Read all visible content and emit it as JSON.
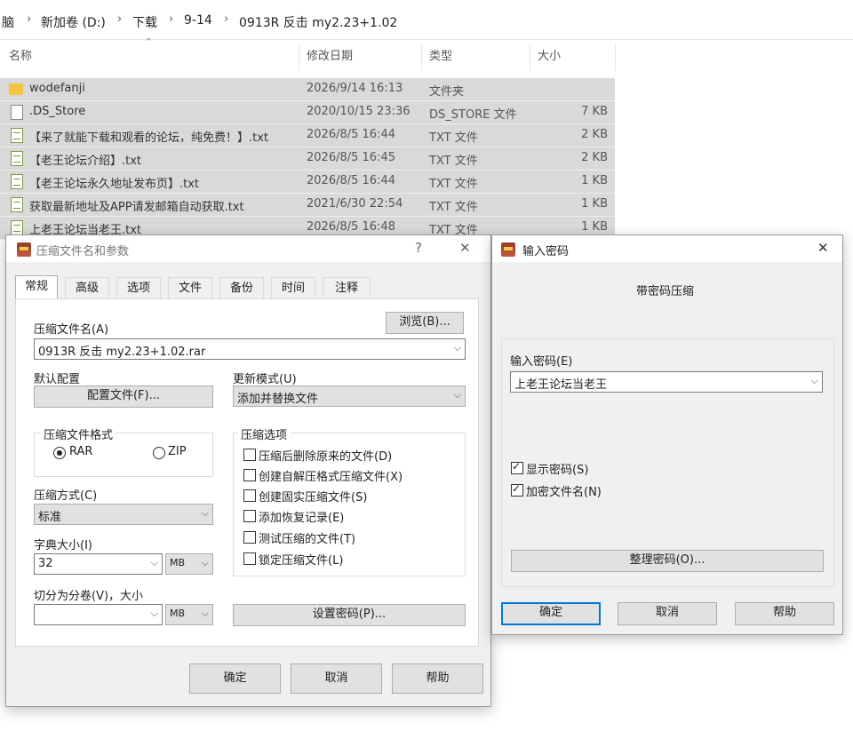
{
  "explorer": {
    "breadcrumb": [
      "脑",
      "新加卷 (D:)",
      "下载",
      "9-14",
      "0913R 反击 my2.23+1.02"
    ],
    "columns": {
      "name": "名称",
      "date": "修改日期",
      "type": "类型",
      "size": "大小"
    },
    "files": [
      {
        "name": "wodefanji",
        "date": "2026/9/14 16:13",
        "type": "文件夹",
        "size": "",
        "icon": "folder-icon"
      },
      {
        "name": ".DS_Store",
        "date": "2020/10/15 23:36",
        "type": "DS_STORE 文件",
        "size": "7 KB",
        "icon": "file-icon"
      },
      {
        "name": "【来了就能下载和观看的论坛，纯免费！】.txt",
        "date": "2026/8/5 16:44",
        "type": "TXT 文件",
        "size": "2 KB",
        "icon": "txt-icon"
      },
      {
        "name": "【老王论坛介绍】.txt",
        "date": "2026/8/5 16:45",
        "type": "TXT 文件",
        "size": "2 KB",
        "icon": "txt-icon"
      },
      {
        "name": "【老王论坛永久地址发布页】.txt",
        "date": "2026/8/5 16:44",
        "type": "TXT 文件",
        "size": "1 KB",
        "icon": "txt-icon"
      },
      {
        "name": "获取最新地址及APP请发邮箱自动获取.txt",
        "date": "2021/6/30 22:54",
        "type": "TXT 文件",
        "size": "1 KB",
        "icon": "txt-icon"
      },
      {
        "name": "上老王论坛当老王.txt",
        "date": "2026/8/5 16:48",
        "type": "TXT 文件",
        "size": "1 KB",
        "icon": "txt-icon"
      }
    ]
  },
  "archive_dialog": {
    "title": "压缩文件名和参数",
    "help_glyph": "?",
    "close_glyph": "✕",
    "tabs": [
      "常规",
      "高级",
      "选项",
      "文件",
      "备份",
      "时间",
      "注释"
    ],
    "filename_label": "压缩文件名(A)",
    "browse": "浏览(B)...",
    "filename": "0913R 反击 my2.23+1.02.rar",
    "profile_label": "默认配置",
    "profile_button": "配置文件(F)...",
    "update_label": "更新模式(U)",
    "update_value": "添加并替换文件",
    "format_label": "压缩文件格式",
    "format_rar": "RAR",
    "format_zip": "ZIP",
    "method_label": "压缩方式(C)",
    "method_value": "标准",
    "dict_label": "字典大小(I)",
    "dict_value": "32",
    "dict_unit": "MB",
    "split_label": "切分为分卷(V)，大小",
    "split_value": "",
    "split_unit": "MB",
    "options_label": "压缩选项",
    "options": [
      {
        "label": "压缩后删除原来的文件(D)",
        "checked": false
      },
      {
        "label": "创建自解压格式压缩文件(X)",
        "checked": false
      },
      {
        "label": "创建固实压缩文件(S)",
        "checked": false
      },
      {
        "label": "添加恢复记录(E)",
        "checked": false
      },
      {
        "label": "测试压缩的文件(T)",
        "checked": false
      },
      {
        "label": "锁定压缩文件(L)",
        "checked": false
      }
    ],
    "set_password": "设置密码(P)...",
    "ok": "确定",
    "cancel": "取消",
    "help": "帮助"
  },
  "password_dialog": {
    "title": "输入密码",
    "close_glyph": "✕",
    "heading": "带密码压缩",
    "password_label": "输入密码(E)",
    "password_value": "上老王论坛当老王",
    "show_password": "显示密码(S)",
    "show_password_checked": true,
    "encrypt_names": "加密文件名(N)",
    "encrypt_names_checked": true,
    "organize": "整理密码(O)...",
    "ok": "确定",
    "cancel": "取消",
    "help": "帮助"
  }
}
